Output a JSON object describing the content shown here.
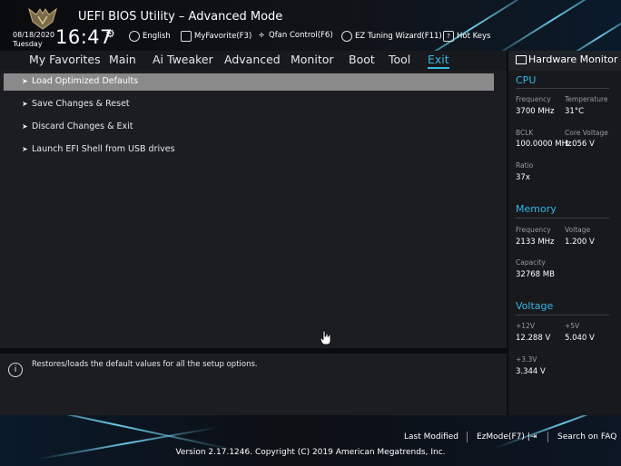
{
  "header": {
    "title": "UEFI BIOS Utility – Advanced Mode",
    "date": "08/18/2020",
    "day": "Tuesday",
    "time": "16:47",
    "tools": [
      {
        "label": "English",
        "icon": "globe-icon"
      },
      {
        "label": "MyFavorite(F3)",
        "icon": "favorite-icon"
      },
      {
        "label": "Qfan Control(F6)",
        "icon": "fan-icon"
      },
      {
        "label": "EZ Tuning Wizard(F11)",
        "icon": "bulb-icon"
      },
      {
        "label": "Hot Keys",
        "icon": "help-icon"
      }
    ]
  },
  "nav": {
    "tabs": [
      "My Favorites",
      "Main",
      "Ai Tweaker",
      "Advanced",
      "Monitor",
      "Boot",
      "Tool",
      "Exit"
    ],
    "active": "Exit"
  },
  "menu": {
    "items": [
      "Load Optimized Defaults",
      "Save Changes & Reset",
      "Discard Changes & Exit",
      "Launch EFI Shell from USB drives"
    ],
    "selected_index": 0
  },
  "help": {
    "text": "Restores/loads the default values for all the setup options."
  },
  "hardware_monitor": {
    "title": "Hardware Monitor",
    "cpu": {
      "heading": "CPU",
      "frequency_label": "Frequency",
      "frequency": "3700 MHz",
      "temperature_label": "Temperature",
      "temperature": "31°C",
      "bclk_label": "BCLK",
      "bclk": "100.0000 MHz",
      "core_voltage_label": "Core Voltage",
      "core_voltage": "1.056 V",
      "ratio_label": "Ratio",
      "ratio": "37x"
    },
    "memory": {
      "heading": "Memory",
      "frequency_label": "Frequency",
      "frequency": "2133 MHz",
      "voltage_label": "Voltage",
      "voltage": "1.200 V",
      "capacity_label": "Capacity",
      "capacity": "32768 MB"
    },
    "voltage": {
      "heading": "Voltage",
      "v12_label": "+12V",
      "v12": "12.288 V",
      "v5_label": "+5V",
      "v5": "5.040 V",
      "v33_label": "+3.3V",
      "v33": "3.344 V"
    }
  },
  "footer": {
    "last_modified": "Last Modified",
    "ezmode": "EzMode(F7)",
    "search_faq": "Search on FAQ",
    "copyright": "Version 2.17.1246. Copyright (C) 2019 American Megatrends, Inc."
  },
  "colors": {
    "accent": "#35b6e6",
    "selected_row": "#8a8a8a",
    "panel": "#1b1d20"
  }
}
